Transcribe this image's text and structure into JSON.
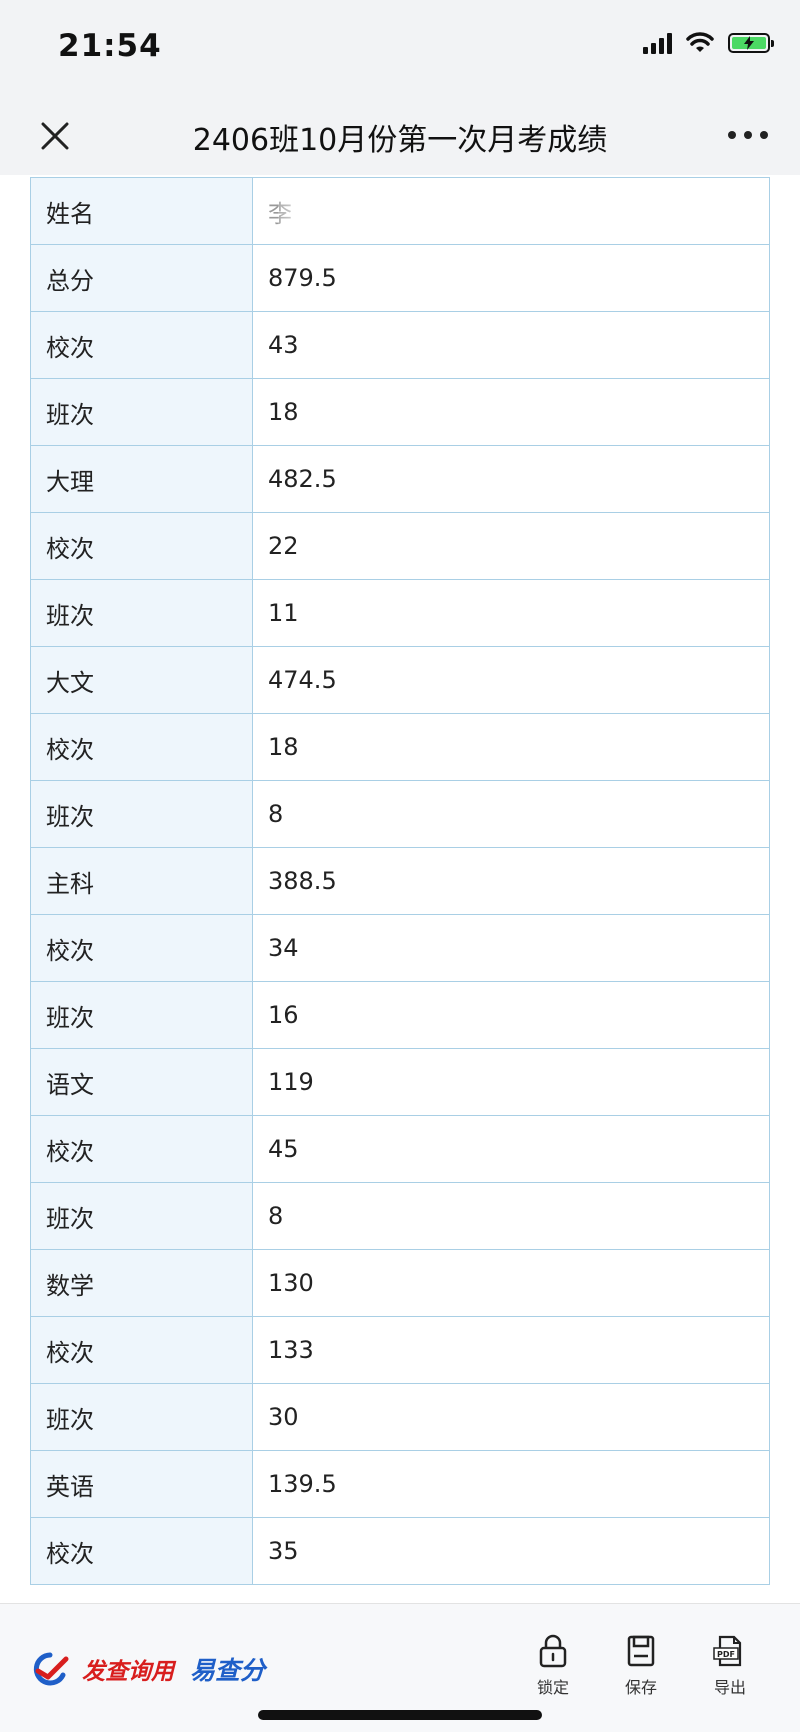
{
  "status_bar": {
    "time": "21:54",
    "battery_color": "#4cd964"
  },
  "nav": {
    "title": "2406班10月份第一次月考成绩",
    "close_icon": "close-icon",
    "more_icon": "more-icon"
  },
  "table": {
    "rows": [
      {
        "label": "姓名",
        "value": "李"
      },
      {
        "label": "总分",
        "value": "879.5"
      },
      {
        "label": "校次",
        "value": "43"
      },
      {
        "label": "班次",
        "value": "18"
      },
      {
        "label": "大理",
        "value": "482.5"
      },
      {
        "label": "校次",
        "value": "22"
      },
      {
        "label": "班次",
        "value": "11"
      },
      {
        "label": "大文",
        "value": "474.5"
      },
      {
        "label": "校次",
        "value": "18"
      },
      {
        "label": "班次",
        "value": "8"
      },
      {
        "label": "主科",
        "value": "388.5"
      },
      {
        "label": "校次",
        "value": "34"
      },
      {
        "label": "班次",
        "value": "16"
      },
      {
        "label": "语文",
        "value": "119"
      },
      {
        "label": "校次",
        "value": "45"
      },
      {
        "label": "班次",
        "value": "8"
      },
      {
        "label": "数学",
        "value": "130"
      },
      {
        "label": "校次",
        "value": "133"
      },
      {
        "label": "班次",
        "value": "30"
      },
      {
        "label": "英语",
        "value": "139.5"
      },
      {
        "label": "校次",
        "value": "35"
      }
    ],
    "label_bg": "#eef6fc",
    "border_color": "#a9cfe5"
  },
  "footer": {
    "slogan": "发查询用",
    "brand_name": "易查分",
    "slogan_color": "#d81e1e",
    "brand_color": "#1f5fc8",
    "lock_label": "锁定",
    "save_label": "保存",
    "export_label": "导出",
    "pdf_text": "PDF"
  }
}
